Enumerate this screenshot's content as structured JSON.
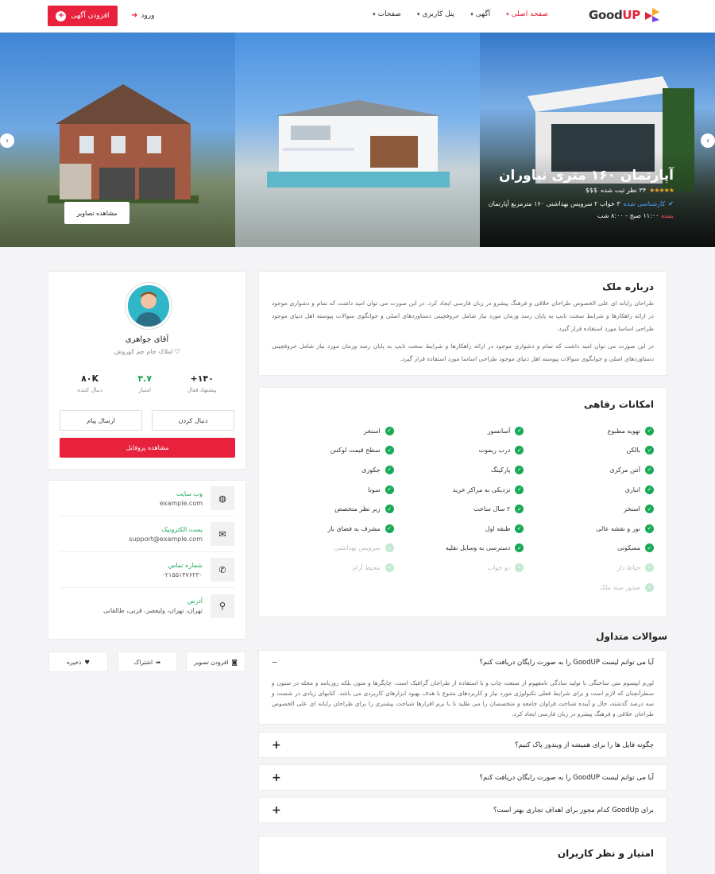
{
  "header": {
    "logo_good": "Good",
    "logo_up": "UP",
    "nav": [
      "صفحه اصلی",
      "آگهی",
      "پنل کاربری",
      "صفحات"
    ],
    "login": "ورود",
    "add_listing": "افزودن آگهی"
  },
  "hero": {
    "title": "آپارتمان ۱۶۰ متری نیاوران",
    "rating_text": "۳۴ نظر ثبت شده",
    "price_level": "$$$",
    "verified": "کارشناسی شده",
    "details": "۳ خواب ۲ سرویس بهداشتی ۱۶۰ مترمربع  آپارتمان",
    "status": "بسته",
    "hours": "۱۱:۰۰ صبح - ۸:۰۰ شب",
    "view_photos": "مشاهده تصاویر"
  },
  "about": {
    "title": "درباره ملک",
    "p1": "طراحان رایانه ای علی الخصوص طراحان خلاقی و فرهنگ پیشرو در زبان فارسی ایجاد کرد. در این صورت می توان امید داشت که تمام و دشواری موجود در ارائه راهکارها و شرایط سخت تایپ به پایان رسد وزمان مورد نیاز شامل حروفچینی دستاوردهای اصلی و جوابگوی سوالات پیوسته اهل دنیای موجود طراحی اساسا مورد استفاده قرار گیرد.",
    "p2": "در این صورت می توان امید داشت که تمام و دشواری موجود در ارائه راهکارها و شرایط سخت تایپ به پایان رسد وزمان مورد نیاز شامل حروفچینی دستاوردهای اصلی و جوابگوی سوالات پیوسته اهل دنیای موجود طراحی اساسا مورد استفاده قرار گیرد."
  },
  "amenities": {
    "title": "امکانات رفاهی",
    "items": [
      {
        "label": "تهویه مطبوع",
        "on": true
      },
      {
        "label": "آسانسور",
        "on": true
      },
      {
        "label": "استخر",
        "on": true
      },
      {
        "label": "بالکن",
        "on": true
      },
      {
        "label": "درب ریموت",
        "on": true
      },
      {
        "label": "سطح قیمت لوکس",
        "on": true
      },
      {
        "label": "آنتن مرکزی",
        "on": true
      },
      {
        "label": "پارکینگ",
        "on": true
      },
      {
        "label": "جکوزی",
        "on": true
      },
      {
        "label": "انباری",
        "on": true
      },
      {
        "label": "نزدیکی به مراکز خرید",
        "on": true
      },
      {
        "label": "سونا",
        "on": true
      },
      {
        "label": "استخر",
        "on": true
      },
      {
        "label": "۲ سال ساخت",
        "on": true
      },
      {
        "label": "زیر نظر متخصص",
        "on": true
      },
      {
        "label": "نور و نقشه عالی",
        "on": true
      },
      {
        "label": "طبقه اول",
        "on": true
      },
      {
        "label": "مشرف به فضای باز",
        "on": true
      },
      {
        "label": "مسکونی",
        "on": true
      },
      {
        "label": "دسترسی به وسایل نقلیه",
        "on": true
      },
      {
        "label": "سرویس بهداشتی",
        "on": false
      },
      {
        "label": "حیاط دار",
        "on": false
      },
      {
        "label": "دو خواب",
        "on": false
      },
      {
        "label": "محیط آرام",
        "on": false
      },
      {
        "label": "صدور سند ملک",
        "on": false
      }
    ]
  },
  "faq": {
    "title": "سوالات متداول",
    "open_q": "آیا می توانم لیست GoodUP را به صورت رایگان دریافت کنم؟",
    "open_a": "لورم ایپسوم متن ساختگی با تولید سادگی نامفهوم از صنعت چاپ و با استفاده از طراحان گرافیک است. چاپگرها و متون بلکه روزنامه و مجله در ستون و سطرآنچنان که لازم است و برای شرایط فعلی تکنولوژی مورد نیاز و کاربردهای متنوع با هدف بهبود ابزارهای کاربردی می باشد. کتابهای زیادی در شصت و سه درصد گذشته، حال و آینده شناخت فراوان جامعه و متخصصان را می طلبد تا با نرم افزارها شناخت بیشتری را برای طراحان رایانه ای علی الخصوص طراحان خلاقی و فرهنگ پیشرو در زبان فارسی ایجاد کرد.",
    "q2": "چگونه فایل ها را برای همیشه از ویندوز پاک کنیم؟",
    "q3": "آیا می توانم لیست GoodUP را به صورت رایگان دریافت کنم؟",
    "q4": "برای GoodUp کدام مجوز برای اهداف تجاری بهتر است؟"
  },
  "review": {
    "title": "امتیاز و نظر کاربران"
  },
  "profile": {
    "name": "آقای جواهری",
    "company": "املاک جام جم کوروش",
    "stats": [
      {
        "value": "۱۴۰+",
        "label": "پیشنهاد فعال"
      },
      {
        "value": "۴.۷",
        "label": "امتیاز"
      },
      {
        "value": "۸۰K",
        "label": "دنبال کننده"
      }
    ],
    "follow": "دنبال کردن",
    "message": "ارسال پیام",
    "view_profile": "مشاهده پروفایل"
  },
  "contacts": [
    {
      "icon": "globe-icon",
      "title": "وب سایت",
      "value": "example.com"
    },
    {
      "icon": "mail-icon",
      "title": "پست الکترونیک",
      "value": "support@example.com"
    },
    {
      "icon": "phone-icon",
      "title": "شماره تماس",
      "value": "۰۲۱۵۵۱۴۷۶۲۳۰"
    },
    {
      "icon": "location-icon",
      "title": "آدرس",
      "value": "تهران، تهران، ولیعصر، قرنی، طالقانی"
    }
  ],
  "actions": {
    "add_photo": "افزودن تصویر",
    "share": "اشتراک",
    "save": "ذخیره"
  },
  "colors": {
    "accent": "#e8213c",
    "green": "#18a957"
  }
}
